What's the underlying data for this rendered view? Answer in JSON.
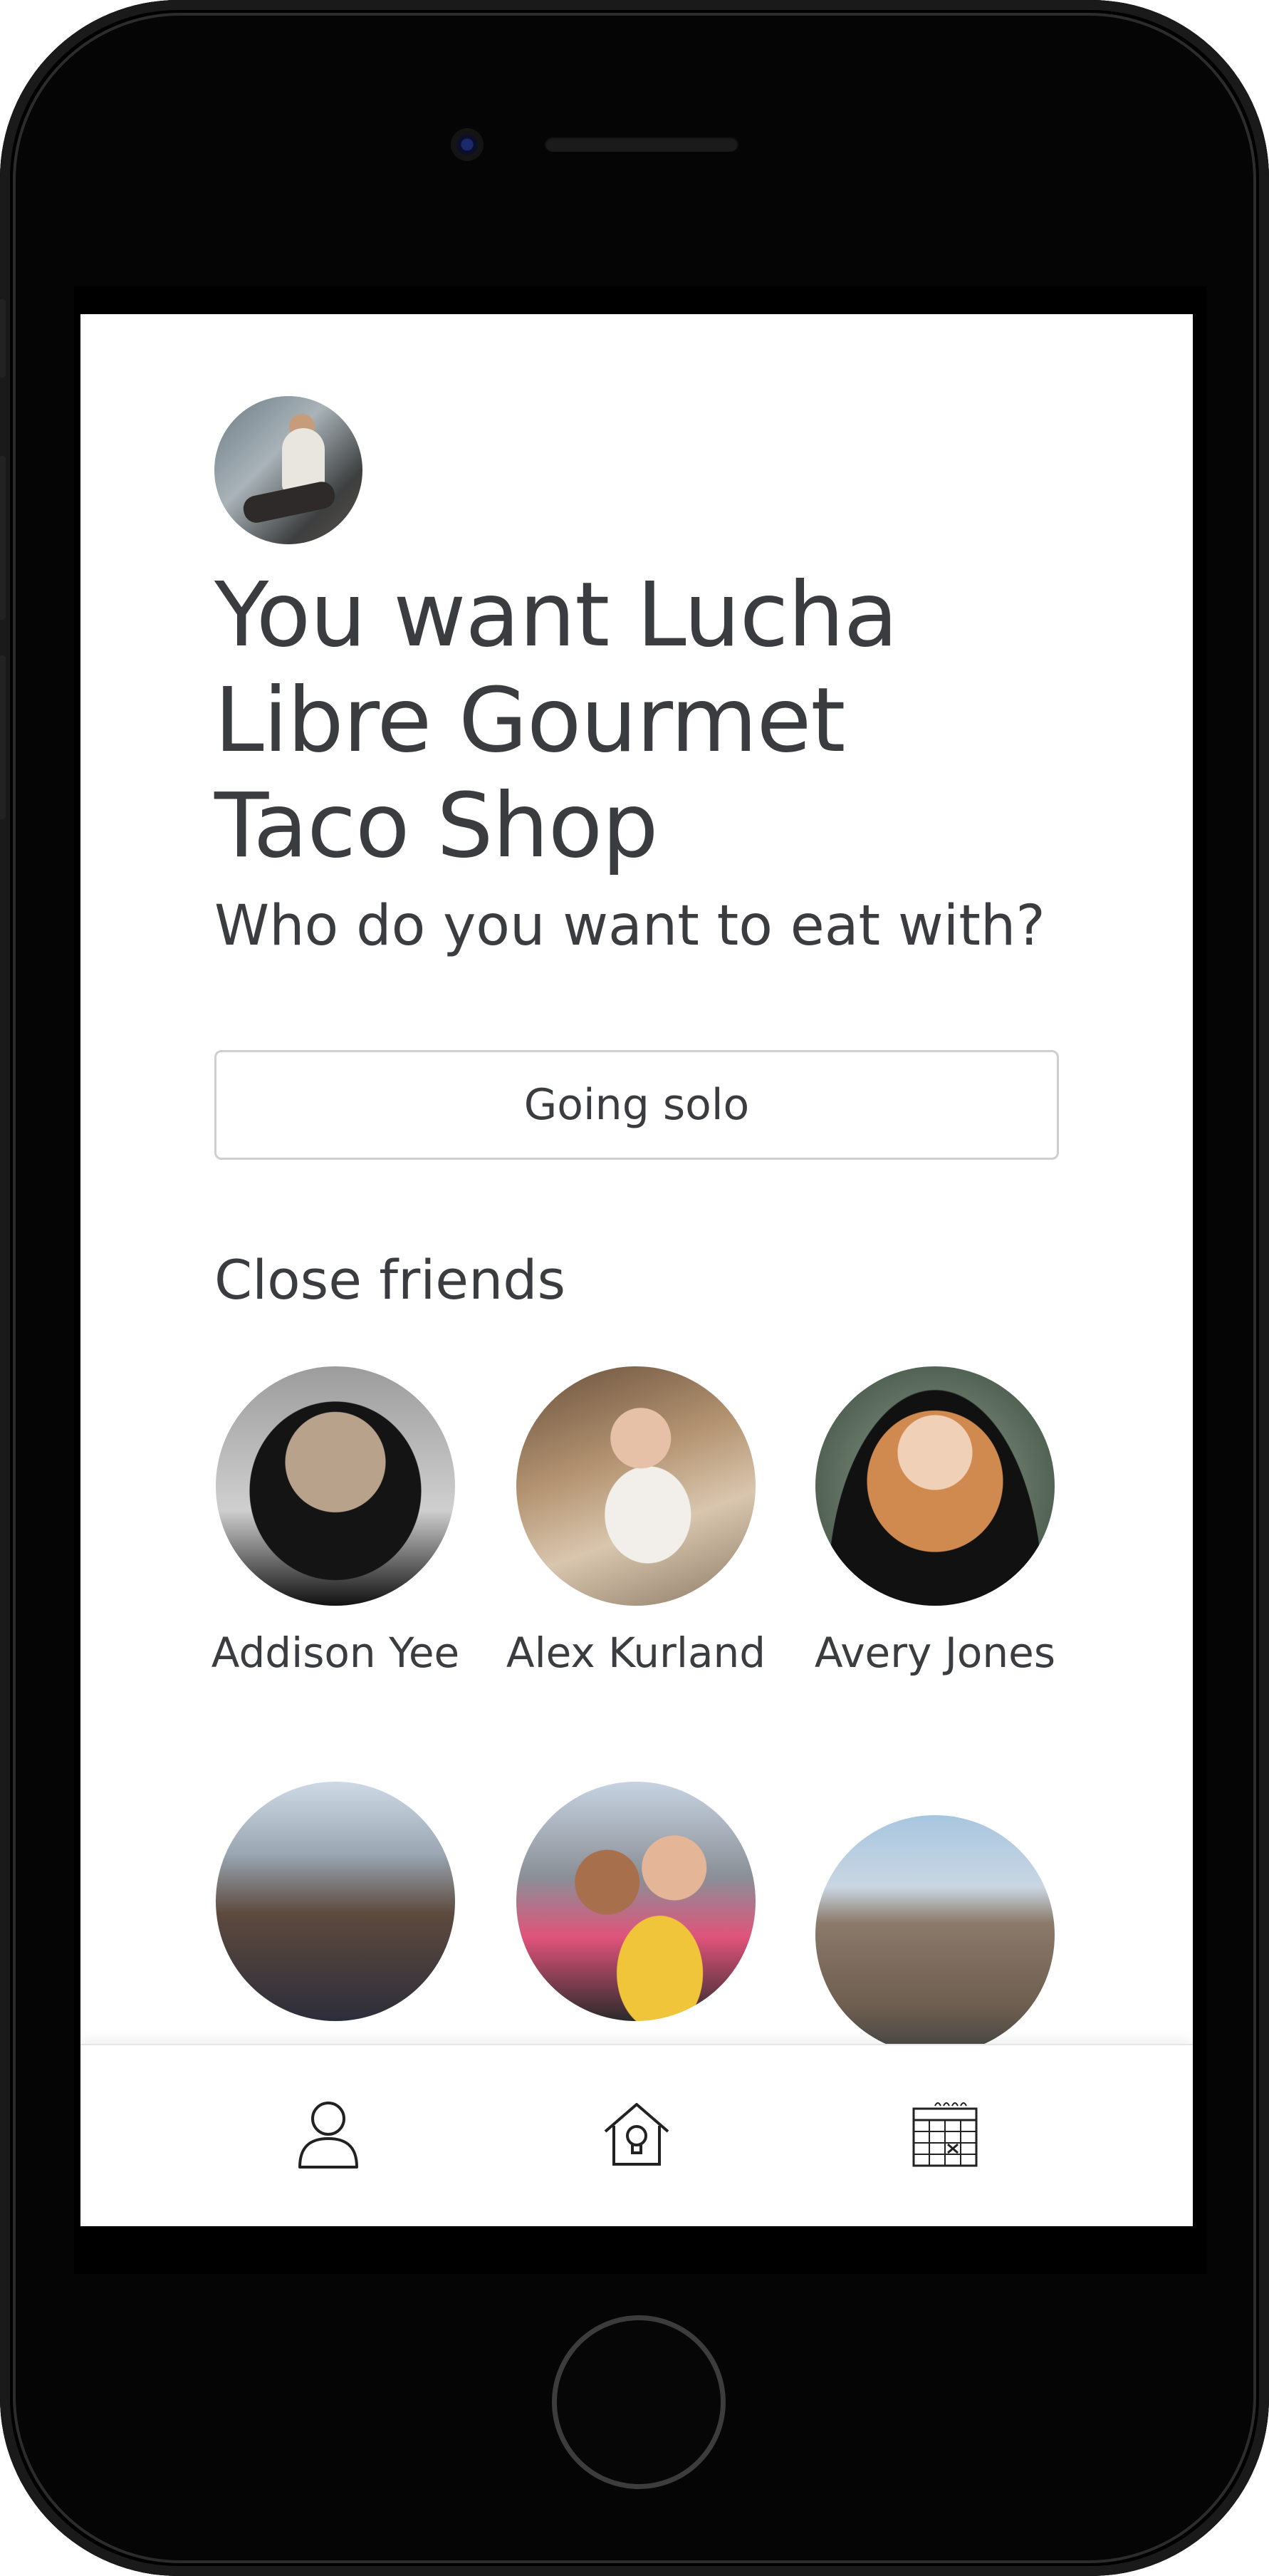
{
  "header": {
    "headline": "You want Lucha Libre Gourmet Taco Shop",
    "question": "Who do you want to eat with?"
  },
  "actions": {
    "solo_label": "Going solo"
  },
  "close_friends": {
    "title": "Close friends",
    "friends": [
      {
        "name": "Addison Yee"
      },
      {
        "name": "Alex Kurland"
      },
      {
        "name": "Avery Jones"
      },
      {
        "name": ""
      },
      {
        "name": ""
      },
      {
        "name": ""
      }
    ]
  },
  "bottom_nav": {
    "items": [
      {
        "icon": "profile-icon"
      },
      {
        "icon": "home-lightbulb-icon"
      },
      {
        "icon": "calendar-icon"
      }
    ]
  },
  "colors": {
    "text": "#3b3c40",
    "border": "#cfcfd1",
    "device": "#050505"
  }
}
